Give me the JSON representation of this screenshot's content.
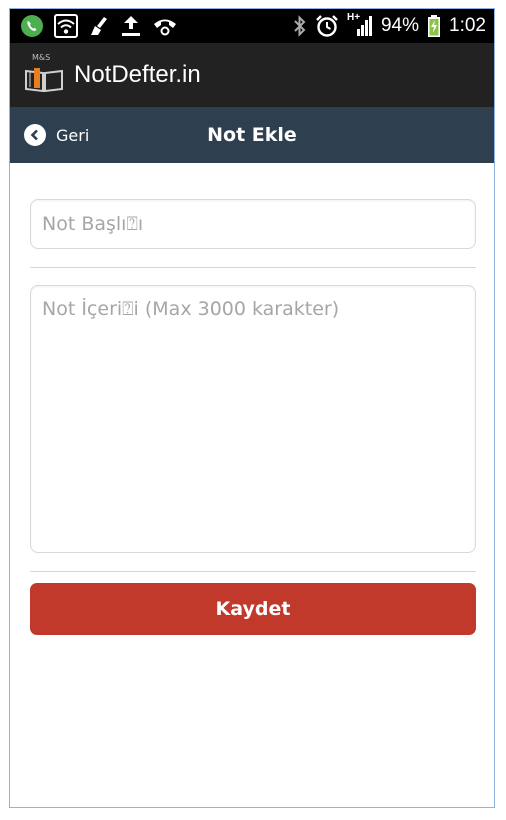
{
  "status_bar": {
    "left_icons": [
      "whatsapp-icon",
      "wifi-icon",
      "cleaner-icon",
      "upload-icon",
      "call-icon"
    ],
    "right_icons": [
      "bluetooth-icon",
      "alarm-icon",
      "signal-icon",
      "battery-charging-icon"
    ],
    "network_label": "H+",
    "battery_percent": "94%",
    "time": "1:02"
  },
  "app_bar": {
    "logo_text": "M&S",
    "title": "NotDefter.in"
  },
  "header": {
    "back_label": "Geri",
    "title": "Not Ekle"
  },
  "form": {
    "title_field": {
      "placeholder": "Not Başlı⍰ı",
      "value": ""
    },
    "content_field": {
      "placeholder": "Not İçeri⍰i (Max 3000 karakter)",
      "value": ""
    },
    "save_label": "Kaydet"
  },
  "colors": {
    "status_bar_bg": "#000000",
    "app_bar_bg": "#222222",
    "header_bg": "#2e3f4f",
    "save_button_bg": "#c0392b",
    "whatsapp_green": "#4caf50",
    "battery_green": "#8bc34a"
  }
}
